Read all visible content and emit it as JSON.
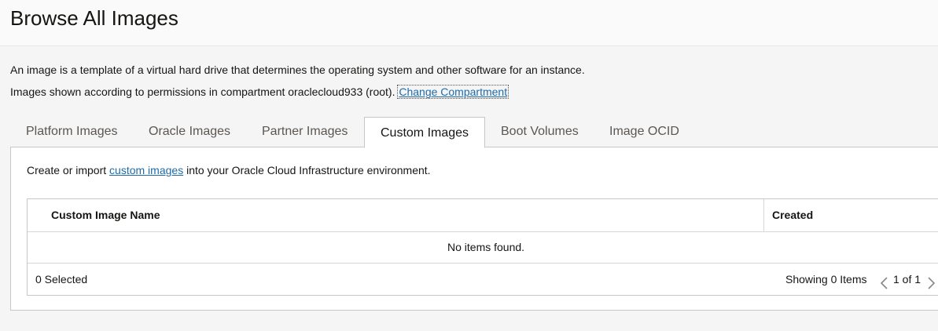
{
  "page": {
    "title": "Browse All Images",
    "description": "An image is a template of a virtual hard drive that determines the operating system and other software for an instance.",
    "permissions_text": "Images shown according to permissions in compartment oraclecloud933 (root).",
    "change_compartment_label": "Change Compartment"
  },
  "tabs": [
    {
      "label": "Platform Images",
      "active": false
    },
    {
      "label": "Oracle Images",
      "active": false
    },
    {
      "label": "Partner Images",
      "active": false
    },
    {
      "label": "Custom Images",
      "active": true
    },
    {
      "label": "Boot Volumes",
      "active": false
    },
    {
      "label": "Image OCID",
      "active": false
    }
  ],
  "panel": {
    "intro_prefix": "Create or import",
    "intro_link": "custom images",
    "intro_suffix": "into your Oracle Cloud Infrastructure environment."
  },
  "table": {
    "columns": [
      "Custom Image Name",
      "Created"
    ],
    "empty_message": "No items found.",
    "selected_text": "0 Selected",
    "showing_text": "Showing 0 Items",
    "page_label": "1 of 1"
  },
  "colors": {
    "link": "#1f6ba8",
    "border": "#c7c7c7",
    "background": "#f5f5f5"
  },
  "icons": {
    "prev": "chevron-left-icon",
    "next": "chevron-right-icon"
  }
}
